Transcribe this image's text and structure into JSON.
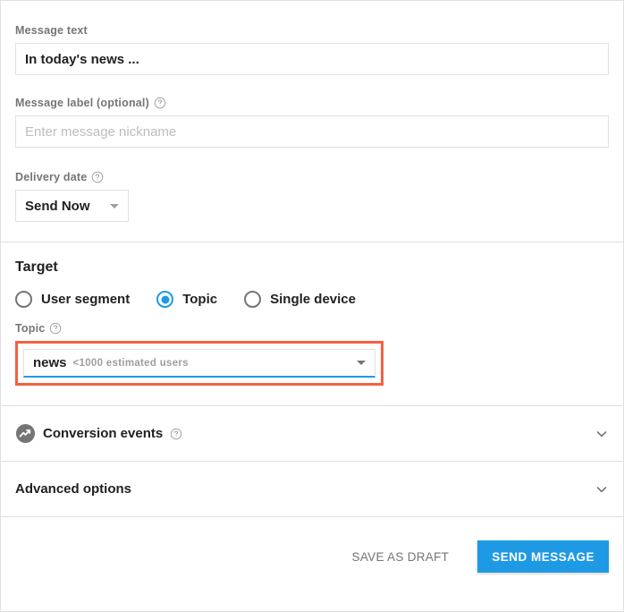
{
  "message_text": {
    "label": "Message text",
    "value": "In today's news ..."
  },
  "message_label": {
    "label": "Message label (optional)",
    "help_icon": "help-circle-icon",
    "placeholder": "Enter message nickname",
    "value": ""
  },
  "delivery_date": {
    "label": "Delivery date",
    "help_icon": "help-circle-icon",
    "selected": "Send Now"
  },
  "target": {
    "title": "Target",
    "options": [
      {
        "label": "User segment",
        "checked": false
      },
      {
        "label": "Topic",
        "checked": true
      },
      {
        "label": "Single device",
        "checked": false
      }
    ],
    "topic_field": {
      "label": "Topic",
      "help_icon": "help-circle-icon",
      "value": "news",
      "estimate": "<1000 estimated users",
      "highlight_color": "#f4613e",
      "underline_color": "#1e9ae5"
    }
  },
  "conversion_events": {
    "title": "Conversion events",
    "icon": "trending-up-circle-icon",
    "help_icon": "help-circle-icon",
    "chevron": "chevron-down-icon"
  },
  "advanced_options": {
    "title": "Advanced options",
    "chevron": "chevron-down-icon"
  },
  "footer": {
    "save_draft_label": "SAVE AS DRAFT",
    "send_message_label": "SEND MESSAGE",
    "primary_color": "#1e9ae5"
  }
}
